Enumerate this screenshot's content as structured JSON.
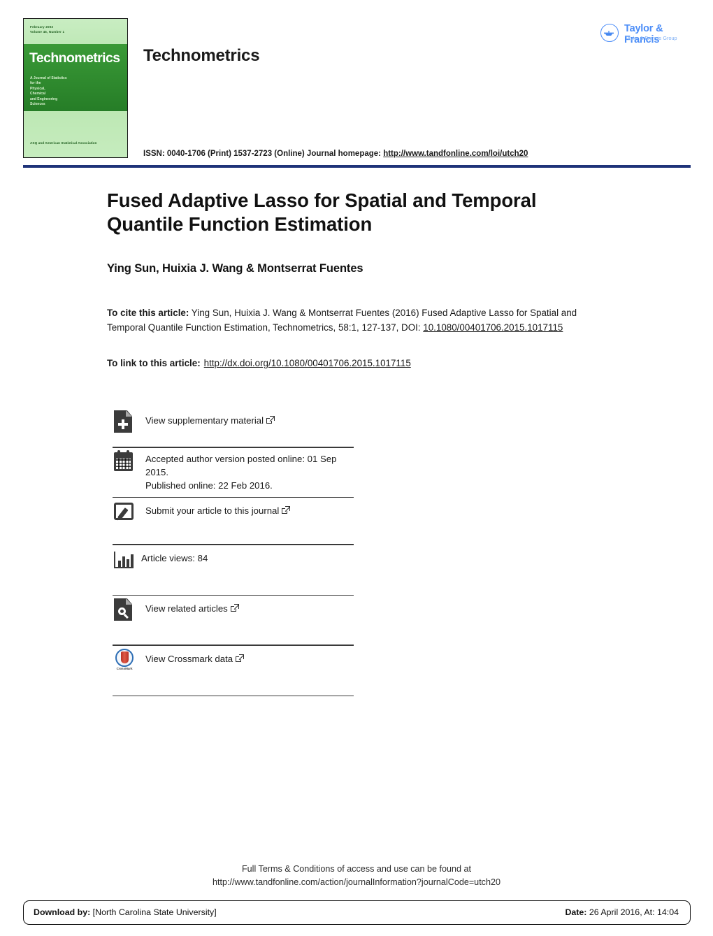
{
  "header": {
    "journal_name": "Technometrics",
    "issn_text": "ISSN: 0040-1706 (Print) 1537-2723 (Online) Journal homepage: ",
    "issn_link": "http://www.tandfonline.com/loi/utch20",
    "rule_color": "#1f3379",
    "cover": {
      "issue_date": "February 2003",
      "issue_volume": "Volume 45, Number 1",
      "title": "Technometrics",
      "subtitle": "A Journal of Statistics\nfor the\nPhysical,\nChemical\nand Engineering\nSciences",
      "association": "ASQ and American Statistical Association",
      "band_color": "#2e8b2e",
      "background_color": "#b9e7b1"
    },
    "publisher_logo": {
      "name": "Taylor & Francis",
      "group": "Taylor & Francis Group",
      "color": "#4b8df8"
    }
  },
  "article": {
    "title": "Fused Adaptive Lasso for Spatial and Temporal Quantile Function Estimation",
    "authors": "Ying Sun, Huixia J. Wang & Montserrat Fuentes",
    "cite_label": "To cite this article:",
    "cite_text": " Ying Sun, Huixia J. Wang & Montserrat Fuentes (2016) Fused Adaptive Lasso for Spatial and Temporal Quantile Function Estimation, Technometrics, 58:1, 127-137, DOI: ",
    "cite_doi": "10.1080/00401706.2015.1017115",
    "link_label": "To link to this article:",
    "link_url": "http://dx.doi.org/10.1080/00401706.2015.1017115"
  },
  "metrics": [
    {
      "icon": "document-plus-icon",
      "label": "View supplementary material",
      "external": true
    },
    {
      "icon": "calendar-icon",
      "label": "Accepted author version posted online: 01 Sep 2015.\nPublished online: 22 Feb 2016.",
      "external": false
    },
    {
      "icon": "pencil-square-icon",
      "label": "Submit your article to this journal",
      "external": true
    },
    {
      "icon": "bar-chart-icon",
      "label": "Article views: 84",
      "external": false
    },
    {
      "icon": "document-search-icon",
      "label": "View related articles",
      "external": true
    },
    {
      "icon": "crossmark-icon",
      "label": "View Crossmark data",
      "external": true,
      "badge_text": "CrossMark"
    }
  ],
  "footer": {
    "terms_line1": "Full Terms & Conditions of access and use can be found at",
    "terms_line2": "http://www.tandfonline.com/action/journalInformation?journalCode=utch20",
    "download_label": "Download by:",
    "download_value": " [North Carolina State University]",
    "date_label": "Date:",
    "date_value": " 26 April 2016, At: 14:04"
  }
}
